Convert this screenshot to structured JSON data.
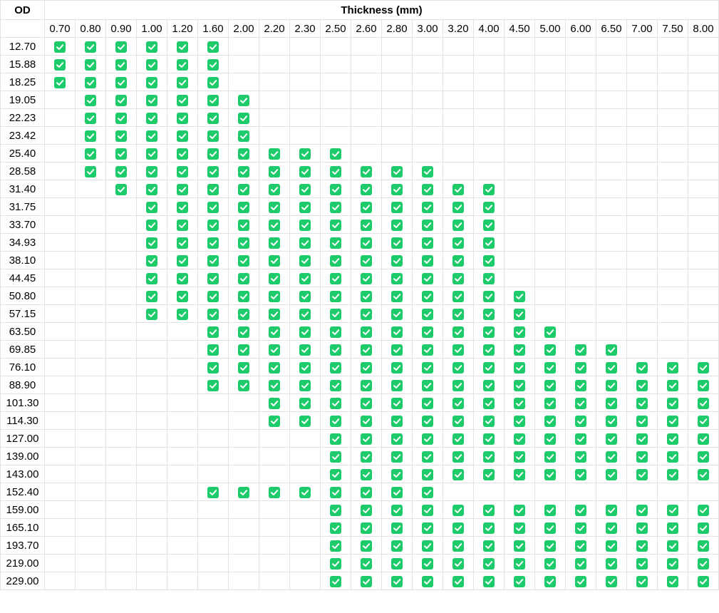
{
  "header": {
    "od_label": "OD",
    "thickness_label": "Thickness (mm)"
  },
  "thicknesses": [
    "0.70",
    "0.80",
    "0.90",
    "1.00",
    "1.20",
    "1.60",
    "2.00",
    "2.20",
    "2.30",
    "2.50",
    "2.60",
    "2.80",
    "3.00",
    "3.20",
    "4.00",
    "4.50",
    "5.00",
    "6.00",
    "6.50",
    "7.00",
    "7.50",
    "8.00"
  ],
  "check_icon": "checkbox-checked-icon",
  "colors": {
    "check": "#1ecb6b",
    "grid": "#e2e2e2"
  },
  "rows": [
    {
      "od": "12.70",
      "checked": [
        "0.70",
        "0.80",
        "0.90",
        "1.00",
        "1.20",
        "1.60"
      ]
    },
    {
      "od": "15.88",
      "checked": [
        "0.70",
        "0.80",
        "0.90",
        "1.00",
        "1.20",
        "1.60"
      ]
    },
    {
      "od": "18.25",
      "checked": [
        "0.70",
        "0.80",
        "0.90",
        "1.00",
        "1.20",
        "1.60"
      ]
    },
    {
      "od": "19.05",
      "checked": [
        "0.80",
        "0.90",
        "1.00",
        "1.20",
        "1.60",
        "2.00"
      ]
    },
    {
      "od": "22.23",
      "checked": [
        "0.80",
        "0.90",
        "1.00",
        "1.20",
        "1.60",
        "2.00"
      ]
    },
    {
      "od": "23.42",
      "checked": [
        "0.80",
        "0.90",
        "1.00",
        "1.20",
        "1.60",
        "2.00"
      ]
    },
    {
      "od": "25.40",
      "checked": [
        "0.80",
        "0.90",
        "1.00",
        "1.20",
        "1.60",
        "2.00",
        "2.20",
        "2.30",
        "2.50"
      ]
    },
    {
      "od": "28.58",
      "checked": [
        "0.80",
        "0.90",
        "1.00",
        "1.20",
        "1.60",
        "2.00",
        "2.20",
        "2.30",
        "2.50",
        "2.60",
        "2.80",
        "3.00"
      ]
    },
    {
      "od": "31.40",
      "checked": [
        "0.90",
        "1.00",
        "1.20",
        "1.60",
        "2.00",
        "2.20",
        "2.30",
        "2.50",
        "2.60",
        "2.80",
        "3.00",
        "3.20",
        "4.00"
      ]
    },
    {
      "od": "31.75",
      "checked": [
        "1.00",
        "1.20",
        "1.60",
        "2.00",
        "2.20",
        "2.30",
        "2.50",
        "2.60",
        "2.80",
        "3.00",
        "3.20",
        "4.00"
      ]
    },
    {
      "od": "33.70",
      "checked": [
        "1.00",
        "1.20",
        "1.60",
        "2.00",
        "2.20",
        "2.30",
        "2.50",
        "2.60",
        "2.80",
        "3.00",
        "3.20",
        "4.00"
      ]
    },
    {
      "od": "34.93",
      "checked": [
        "1.00",
        "1.20",
        "1.60",
        "2.00",
        "2.20",
        "2.30",
        "2.50",
        "2.60",
        "2.80",
        "3.00",
        "3.20",
        "4.00"
      ]
    },
    {
      "od": "38.10",
      "checked": [
        "1.00",
        "1.20",
        "1.60",
        "2.00",
        "2.20",
        "2.30",
        "2.50",
        "2.60",
        "2.80",
        "3.00",
        "3.20",
        "4.00"
      ]
    },
    {
      "od": "44.45",
      "checked": [
        "1.00",
        "1.20",
        "1.60",
        "2.00",
        "2.20",
        "2.30",
        "2.50",
        "2.60",
        "2.80",
        "3.00",
        "3.20",
        "4.00"
      ]
    },
    {
      "od": "50.80",
      "checked": [
        "1.00",
        "1.20",
        "1.60",
        "2.00",
        "2.20",
        "2.30",
        "2.50",
        "2.60",
        "2.80",
        "3.00",
        "3.20",
        "4.00",
        "4.50"
      ]
    },
    {
      "od": "57.15",
      "checked": [
        "1.00",
        "1.20",
        "1.60",
        "2.00",
        "2.20",
        "2.30",
        "2.50",
        "2.60",
        "2.80",
        "3.00",
        "3.20",
        "4.00",
        "4.50"
      ]
    },
    {
      "od": "63.50",
      "checked": [
        "1.60",
        "2.00",
        "2.20",
        "2.30",
        "2.50",
        "2.60",
        "2.80",
        "3.00",
        "3.20",
        "4.00",
        "4.50",
        "5.00"
      ]
    },
    {
      "od": "69.85",
      "checked": [
        "1.60",
        "2.00",
        "2.20",
        "2.30",
        "2.50",
        "2.60",
        "2.80",
        "3.00",
        "3.20",
        "4.00",
        "4.50",
        "5.00",
        "6.00",
        "6.50"
      ]
    },
    {
      "od": "76.10",
      "checked": [
        "1.60",
        "2.00",
        "2.20",
        "2.30",
        "2.50",
        "2.60",
        "2.80",
        "3.00",
        "3.20",
        "4.00",
        "4.50",
        "5.00",
        "6.00",
        "6.50",
        "7.00",
        "7.50",
        "8.00"
      ]
    },
    {
      "od": "88.90",
      "checked": [
        "1.60",
        "2.00",
        "2.20",
        "2.30",
        "2.50",
        "2.60",
        "2.80",
        "3.00",
        "3.20",
        "4.00",
        "4.50",
        "5.00",
        "6.00",
        "6.50",
        "7.00",
        "7.50",
        "8.00"
      ]
    },
    {
      "od": "101.30",
      "checked": [
        "2.20",
        "2.30",
        "2.50",
        "2.60",
        "2.80",
        "3.00",
        "3.20",
        "4.00",
        "4.50",
        "5.00",
        "6.00",
        "6.50",
        "7.00",
        "7.50",
        "8.00"
      ]
    },
    {
      "od": "114.30",
      "checked": [
        "2.20",
        "2.30",
        "2.50",
        "2.60",
        "2.80",
        "3.00",
        "3.20",
        "4.00",
        "4.50",
        "5.00",
        "6.00",
        "6.50",
        "7.00",
        "7.50",
        "8.00"
      ]
    },
    {
      "od": "127.00",
      "checked": [
        "2.50",
        "2.60",
        "2.80",
        "3.00",
        "3.20",
        "4.00",
        "4.50",
        "5.00",
        "6.00",
        "6.50",
        "7.00",
        "7.50",
        "8.00"
      ]
    },
    {
      "od": "139.00",
      "checked": [
        "2.50",
        "2.60",
        "2.80",
        "3.00",
        "3.20",
        "4.00",
        "4.50",
        "5.00",
        "6.00",
        "6.50",
        "7.00",
        "7.50",
        "8.00"
      ]
    },
    {
      "od": "143.00",
      "checked": [
        "2.50",
        "2.60",
        "2.80",
        "3.00",
        "3.20",
        "4.00",
        "4.50",
        "5.00",
        "6.00",
        "6.50",
        "7.00",
        "7.50",
        "8.00"
      ]
    },
    {
      "od": "152.40",
      "checked": [
        "1.60",
        "2.00",
        "2.20",
        "2.30",
        "2.50",
        "2.60",
        "2.80",
        "3.00"
      ]
    },
    {
      "od": "159.00",
      "checked": [
        "2.50",
        "2.60",
        "2.80",
        "3.00",
        "3.20",
        "4.00",
        "4.50",
        "5.00",
        "6.00",
        "6.50",
        "7.00",
        "7.50",
        "8.00"
      ]
    },
    {
      "od": "165.10",
      "checked": [
        "2.50",
        "2.60",
        "2.80",
        "3.00",
        "3.20",
        "4.00",
        "4.50",
        "5.00",
        "6.00",
        "6.50",
        "7.00",
        "7.50",
        "8.00"
      ]
    },
    {
      "od": "193.70",
      "checked": [
        "2.50",
        "2.60",
        "2.80",
        "3.00",
        "3.20",
        "4.00",
        "4.50",
        "5.00",
        "6.00",
        "6.50",
        "7.00",
        "7.50",
        "8.00"
      ]
    },
    {
      "od": "219.00",
      "checked": [
        "2.50",
        "2.60",
        "2.80",
        "3.00",
        "3.20",
        "4.00",
        "4.50",
        "5.00",
        "6.00",
        "6.50",
        "7.00",
        "7.50",
        "8.00"
      ]
    },
    {
      "od": "229.00",
      "checked": [
        "2.50",
        "2.60",
        "2.80",
        "3.00",
        "3.20",
        "4.00",
        "4.50",
        "5.00",
        "6.00",
        "6.50",
        "7.00",
        "7.50",
        "8.00"
      ]
    }
  ]
}
